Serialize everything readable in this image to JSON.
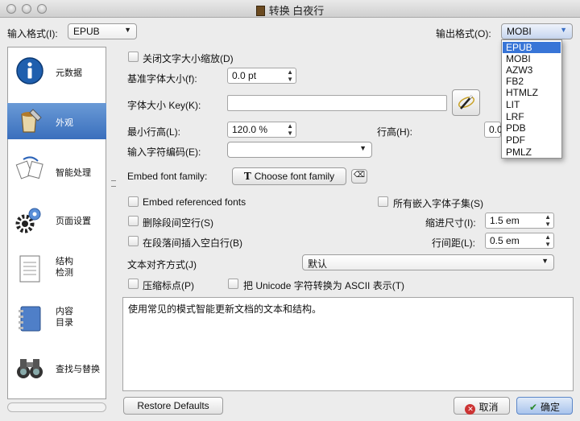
{
  "window": {
    "title": "转换 白夜行"
  },
  "input_format": {
    "label": "输入格式(I):",
    "value": "EPUB"
  },
  "output_format": {
    "label": "输出格式(O):",
    "value": "MOBI",
    "options": [
      "EPUB",
      "MOBI",
      "AZW3",
      "FB2",
      "HTMLZ",
      "LIT",
      "LRF",
      "PDB",
      "PDF",
      "PMLZ"
    ]
  },
  "sidebar": {
    "items": [
      {
        "label": "元数据"
      },
      {
        "label": "外观"
      },
      {
        "label": "智能处理"
      },
      {
        "label": "页面设置"
      },
      {
        "label": "结构\n检测"
      },
      {
        "label": "内容\n目录"
      },
      {
        "label": "查找与替换"
      }
    ]
  },
  "form": {
    "disable_font_rescaling": "关闭文字大小缩放(D)",
    "base_font_size_label": "基准字体大小(f):",
    "base_font_size_value": "0.0 pt",
    "font_size_key_label": "字体大小 Key(K):",
    "min_line_height_label": "最小行高(L):",
    "min_line_height_value": "120.0 %",
    "line_height_label": "行高(H):",
    "line_height_value": "0.0",
    "input_encoding_label": "输入字符编码(E):",
    "embed_font_family_label": "Embed font family:",
    "choose_font_button": "Choose font family",
    "embed_referenced_fonts": "Embed referenced fonts",
    "subset_all_fonts": "所有嵌入字体子集(S)",
    "remove_paragraph_spacing": "删除段间空行(S)",
    "indent_size_label": "缩进尺寸(I):",
    "indent_size_value": "1.5 em",
    "insert_blank_line": "在段落间插入空白行(B)",
    "line_spacing_label": "行间距(L):",
    "line_spacing_value": "0.5 em",
    "text_justification_label": "文本对齐方式(J)",
    "text_justification_value": "默认",
    "smarten_punctuation": "压缩标点(P)",
    "unicode_to_ascii": "把 Unicode 字符转换为 ASCII 表示(T)"
  },
  "description": "使用常见的模式智能更新文档的文本和结构。",
  "buttons": {
    "restore_defaults": "Restore Defaults",
    "cancel": "取消",
    "ok": "确定"
  }
}
